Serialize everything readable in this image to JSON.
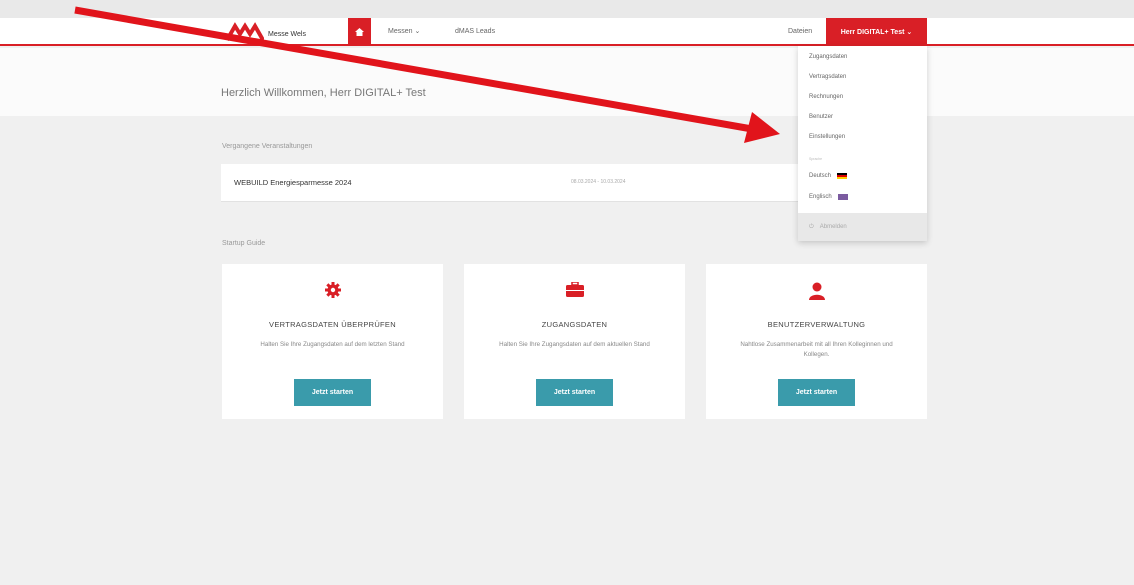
{
  "header": {
    "brand": "Messe Wels",
    "nav": {
      "messen": "Messen",
      "leads": "dMAS Leads",
      "dateien": "Dateien"
    },
    "user_button": "Herr DIGITAL+ Test"
  },
  "welcome": "Herzlich Willkommen, Herr DIGITAL+ Test",
  "past_events": {
    "label": "Vergangene Veranstaltungen",
    "items": [
      {
        "name": "WEBUILD Energiesparmesse 2024",
        "date": "08.03.2024 - 10.03.2024"
      }
    ]
  },
  "startup_guide": {
    "label": "Startup Guide",
    "cards": [
      {
        "icon": "gear-icon",
        "title": "VERTRAGSDATEN ÜBERPRÜFEN",
        "desc": "Halten Sie Ihre Zugangsdaten auf dem letzten Stand",
        "button": "Jetzt starten"
      },
      {
        "icon": "briefcase-icon",
        "title": "ZUGANGSDATEN",
        "desc": "Halten Sie Ihre Zugangsdaten auf dem aktuellen Stand",
        "button": "Jetzt starten"
      },
      {
        "icon": "user-icon",
        "title": "BENUTZERVERWALTUNG",
        "desc": "Nahtlose Zusammenarbeit mit all Ihren Kolleginnen und Kollegen.",
        "button": "Jetzt starten"
      }
    ]
  },
  "dropdown": {
    "items": [
      "Zugangsdaten",
      "Vertragsdaten",
      "Rechnungen",
      "Benutzer",
      "Einstellungen"
    ],
    "language_label": "Sprache",
    "languages": [
      "Deutsch",
      "Englisch"
    ],
    "logout": "Abmelden"
  },
  "colors": {
    "brand_red": "#d91f26",
    "button_teal": "#3a9bab",
    "arrow_red": "#e1141b"
  }
}
